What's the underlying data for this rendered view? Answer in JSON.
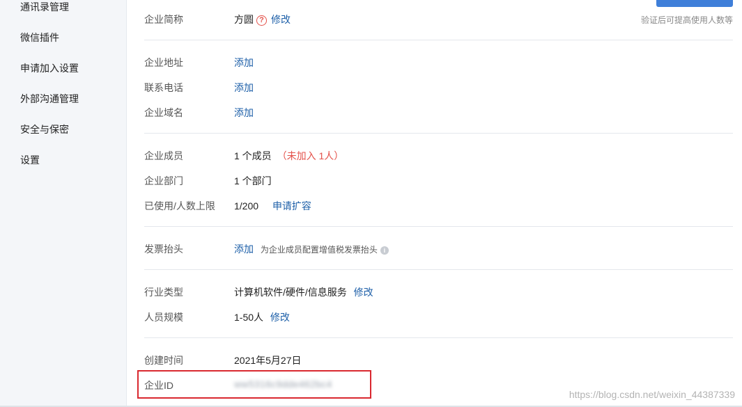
{
  "sidebar": {
    "items": [
      {
        "label": "通讯录管理"
      },
      {
        "label": "微信插件"
      },
      {
        "label": "申请加入设置"
      },
      {
        "label": "外部沟通管理"
      },
      {
        "label": "安全与保密"
      },
      {
        "label": "设置"
      }
    ]
  },
  "header": {
    "verify_hint": "验证后可提高使用人数等"
  },
  "rows": {
    "short_name": {
      "label": "企业简称",
      "value": "方圆",
      "action": "修改"
    },
    "address": {
      "label": "企业地址",
      "action": "添加"
    },
    "phone": {
      "label": "联系电话",
      "action": "添加"
    },
    "domain": {
      "label": "企业域名",
      "action": "添加"
    },
    "members": {
      "label": "企业成员",
      "value": "1 个成员",
      "note": "（未加入 1人）"
    },
    "departments": {
      "label": "企业部门",
      "value": "1 个部门"
    },
    "usage": {
      "label": "已使用/人数上限",
      "value": "1/200",
      "action": "申请扩容"
    },
    "invoice": {
      "label": "发票抬头",
      "action": "添加",
      "hint": "为企业成员配置增值税发票抬头"
    },
    "industry": {
      "label": "行业类型",
      "value": "计算机软件/硬件/信息服务",
      "action": "修改"
    },
    "scale": {
      "label": "人员规模",
      "value": "1-50人",
      "action": "修改"
    },
    "created": {
      "label": "创建时间",
      "value": "2021年5月27日"
    },
    "corp_id": {
      "label": "企业ID",
      "value": "ww5316c9dde462bc4"
    }
  },
  "watermark": "https://blog.csdn.net/weixin_44387339",
  "colors": {
    "link": "#1d5fa8",
    "danger": "#e4524b",
    "highlight": "#d9282f",
    "sidebar_bg": "#f4f6f9",
    "top_button": "#3f7fd9"
  },
  "icons": {
    "help": "question-circle-icon",
    "info": "info-circle-icon"
  }
}
